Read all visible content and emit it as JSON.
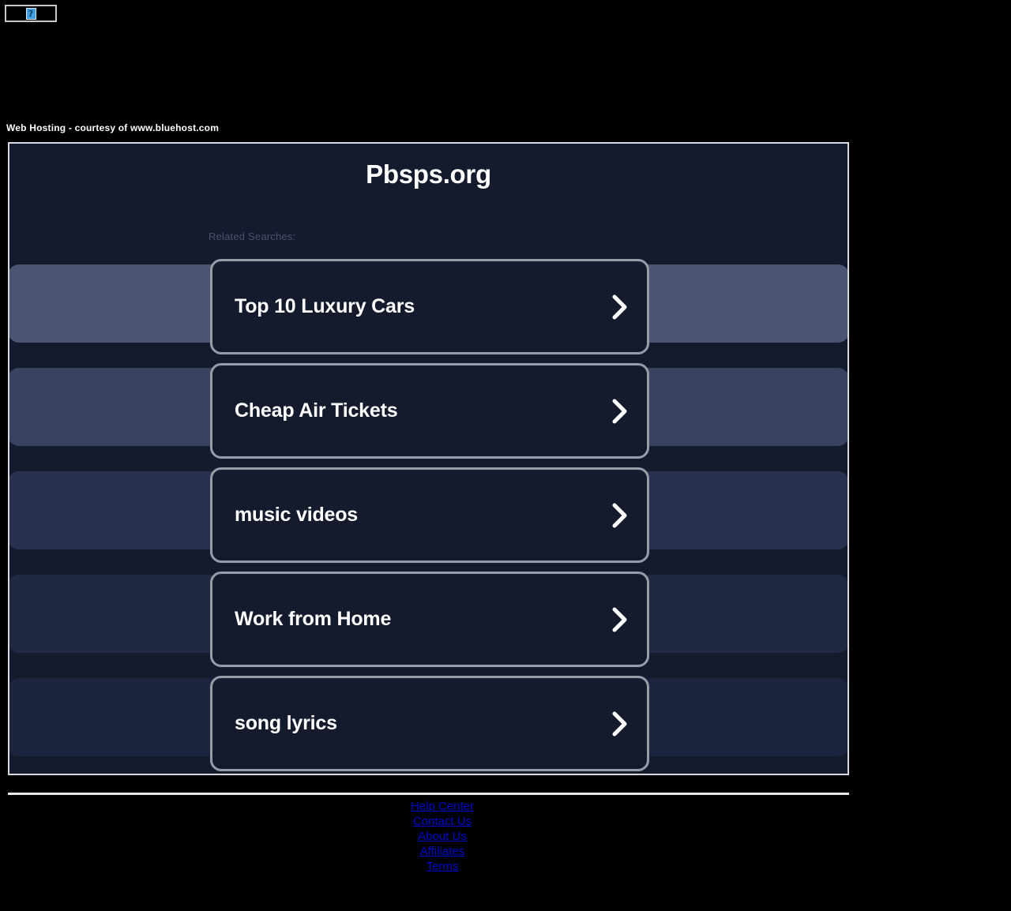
{
  "placeholder_image": {
    "icon": "broken-image-icon",
    "glyph": "?"
  },
  "host_notice": "Web Hosting - courtesy of www.bluehost.com",
  "panel": {
    "title": "Pbsps.org",
    "related_label": "Related Searches:",
    "background_color": "#141b2d",
    "border_color": "#d6d9de",
    "ghost_bars": [
      "#4c5473",
      "#3a4261",
      "#29314f",
      "#202843",
      "#1c2440"
    ],
    "cards": [
      {
        "label": "Top 10 Luxury Cars",
        "icon": "chevron-right-icon"
      },
      {
        "label": "Cheap Air Tickets",
        "icon": "chevron-right-icon"
      },
      {
        "label": "music videos",
        "icon": "chevron-right-icon"
      },
      {
        "label": "Work from Home",
        "icon": "chevron-right-icon"
      },
      {
        "label": "song lyrics",
        "icon": "chevron-right-icon"
      }
    ],
    "card_border_color": "#989ca6",
    "card_text_color": "#ffffff"
  },
  "footer": {
    "links": [
      "Help Center",
      "Contact Us",
      "About Us",
      "Affiliates",
      "Terms"
    ],
    "link_color": "#0000cc"
  }
}
